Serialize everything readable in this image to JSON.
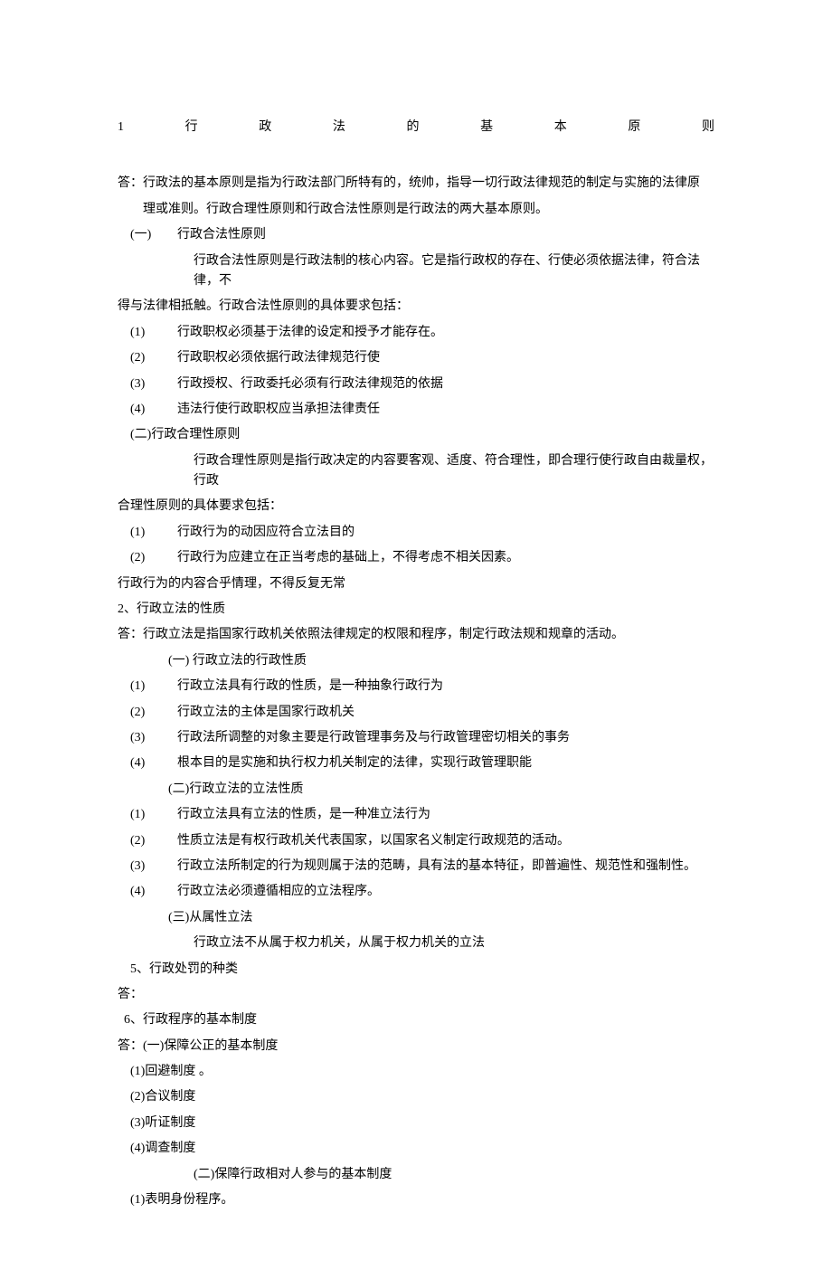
{
  "title": {
    "num": "1",
    "chars": [
      "行",
      "政",
      "法",
      "的",
      "基",
      "本",
      "原",
      "则"
    ]
  },
  "ans1_prefix": "答：",
  "ans1_l1": "行政法的基本原则是指为行政法部门所特有的，统帅，指导一切行政法律规范的制定与实施的法律原",
  "ans1_l2": "理或准则。行政合理性原则和行政合法性原则是行政法的两大基本原则。",
  "s1_head_num": "(一)",
  "s1_head_txt": "行政合法性原则",
  "s1_intro_l1": "行政合法性原则是行政法制的核心内容。它是指行政权的存在、行使必须依据法律，符合法律，不",
  "s1_intro_l2": "得与法律相抵触。行政合法性原则的具体要求包括：",
  "s1_1n": "(1)",
  "s1_1t": "行政职权必须基于法律的设定和授予才能存在。",
  "s1_2n": "(2)",
  "s1_2t": "行政职权必须依据行政法律规范行使",
  "s1_3n": "(3)",
  "s1_3t": "行政授权、行政委托必须有行政法律规范的依据",
  "s1_4n": "(4)",
  "s1_4t": "违法行使行政职权应当承担法律责任",
  "s2_head": "(二)行政合理性原则",
  "s2_intro_l1": "行政合理性原则是指行政决定的内容要客观、适度、符合理性，即合理行使行政自由裁量权，行政",
  "s2_intro_l2": "合理性原则的具体要求包括：",
  "s2_1n": "(1)",
  "s2_1t": "行政行为的动因应符合立法目的",
  "s2_2n": "(2)",
  "s2_2t": "行政行为应建立在正当考虑的基础上，不得考虑不相关因素。",
  "s2_tail": "行政行为的内容合乎情理，不得反复无常",
  "q2": "2、行政立法的性质",
  "a2_l1": "答：行政立法是指国家行政机关依照法律规定的权限和程序，制定行政法规和规章的活动。",
  "a2_s1": "(一) 行政立法的行政性质",
  "a2_s1_1n": "(1)",
  "a2_s1_1t": "行政立法具有行政的性质，是一种抽象行政行为",
  "a2_s1_2n": "(2)",
  "a2_s1_2t": "行政立法的主体是国家行政机关",
  "a2_s1_3n": "(3)",
  "a2_s1_3t": "行政法所调整的对象主要是行政管理事务及与行政管理密切相关的事务",
  "a2_s1_4n": "(4)",
  "a2_s1_4t": "根本目的是实施和执行权力机关制定的法律，实现行政管理职能",
  "a2_s2": "(二)行政立法的立法性质",
  "a2_s2_1n": "(1)",
  "a2_s2_1t": "行政立法具有立法的性质，是一种准立法行为",
  "a2_s2_2n": "(2)",
  "a2_s2_2t": "性质立法是有权行政机关代表国家，以国家名义制定行政规范的活动。",
  "a2_s2_3n": "(3)",
  "a2_s2_3t": "行政立法所制定的行为规则属于法的范畴，具有法的基本特征，即普遍性、规范性和强制性。",
  "a2_s2_4n": "(4)",
  "a2_s2_4t": "行政立法必须遵循相应的立法程序。",
  "a2_s3": "(三)从属性立法",
  "a2_s3_t": "行政立法不从属于权力机关，从属于权力机关的立法",
  "q5": "5、行政处罚的种类",
  "a5": "答：",
  "q6": "6、行政程序的基本制度",
  "a6_l1": "答：(一)保障公正的基本制度",
  "a6_1": "(1)回避制度 。",
  "a6_2": "(2)合议制度",
  "a6_3": "(3)听证制度",
  "a6_4": "(4)调查制度",
  "a6_s2": "(二)保障行政相对人参与的基本制度",
  "a6_s2_1": "(1)表明身份程序。"
}
